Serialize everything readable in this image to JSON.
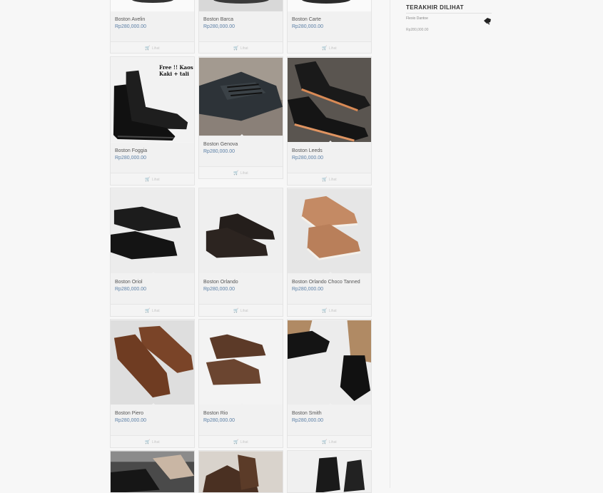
{
  "products": [
    {
      "name": "Boston Avelin",
      "price": "Rp280,000.00",
      "button": "Lihat"
    },
    {
      "name": "Boston Barca",
      "price": "Rp280,000.00",
      "button": "Lihat"
    },
    {
      "name": "Boston Carte",
      "price": "Rp280,000.00",
      "button": "Lihat"
    },
    {
      "name": "Boston Foggia",
      "price": "Rp280,000.00",
      "button": "Lihat",
      "image_text": "Free !! Kaos Kaki + tali"
    },
    {
      "name": "Boston Genova",
      "price": "Rp280,000.00",
      "button": "Lihat"
    },
    {
      "name": "Boston Leeds",
      "price": "Rp280,000.00",
      "button": "Lihat"
    },
    {
      "name": "Boston Oriol",
      "price": "Rp280,000.00",
      "button": "Lihat"
    },
    {
      "name": "Boston Orlando",
      "price": "Rp280,000.00",
      "button": "Lihat"
    },
    {
      "name": "Boston Orlando Choco Tanned",
      "price": "Rp280,000.00",
      "button": "Lihat"
    },
    {
      "name": "Boston Piero",
      "price": "Rp280,000.00",
      "button": "Lihat"
    },
    {
      "name": "Boston Rio",
      "price": "Rp280,000.00",
      "button": "Lihat"
    },
    {
      "name": "Boston Smith",
      "price": "Rp280,000.00",
      "button": "Lihat"
    }
  ],
  "sidebar": {
    "title": "TERAKHIR DILIHAT",
    "recent": [
      {
        "name": "Flexio Dantoe",
        "price": "Rp280,000.00"
      }
    ]
  },
  "colors": {
    "price": "#5b7fa6",
    "background": "#f7f7f7",
    "card": "#f1f1f1"
  },
  "icons": {
    "button_icon": "cart-icon"
  }
}
